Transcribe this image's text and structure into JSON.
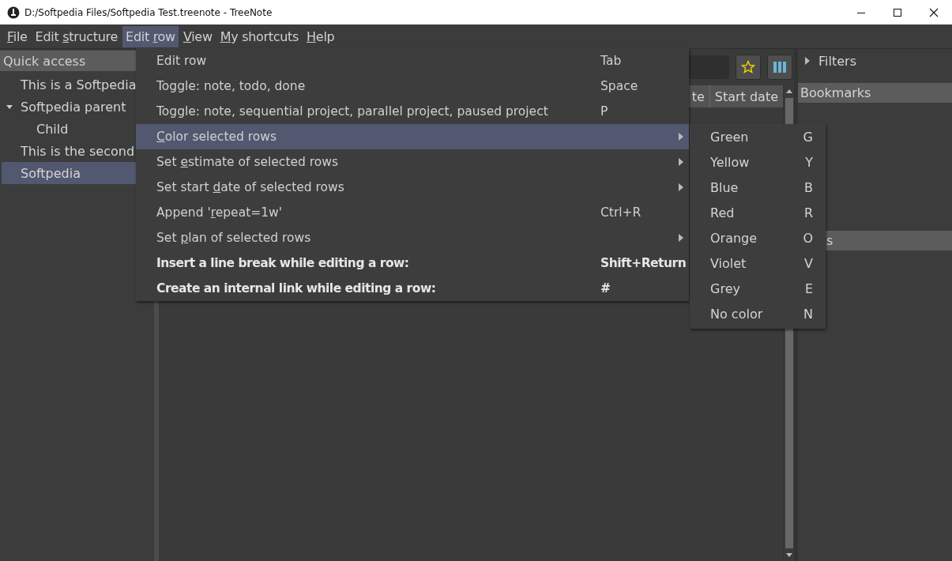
{
  "window": {
    "title": "D:/Softpedia Files/Softpedia Test.treenote - TreeNote"
  },
  "menu_bar": [
    {
      "label": {
        "key": "F",
        "after": "ile"
      },
      "selected": false
    },
    {
      "label": {
        "before": "Edit ",
        "key": "s",
        "after": "tructure"
      },
      "selected": false
    },
    {
      "label": {
        "before": "Edit ",
        "key": "r",
        "after": "ow"
      },
      "selected": true
    },
    {
      "label": {
        "key": "V",
        "after": "iew"
      },
      "selected": false
    },
    {
      "label": {
        "key": "M",
        "after": "y shortcuts"
      },
      "selected": false
    },
    {
      "label": {
        "key": "H",
        "after": "elp"
      },
      "selected": false
    }
  ],
  "sidebar": {
    "title": "Quick access",
    "items": [
      {
        "label": "This is a Softpedia",
        "selected": false
      },
      {
        "label": "Softpedia parent",
        "selected": false,
        "expanded": true,
        "children": [
          {
            "label": "Child",
            "selected": false
          }
        ]
      },
      {
        "label": "This is the second",
        "selected": false
      },
      {
        "label": "Softpedia",
        "selected": true
      }
    ]
  },
  "table": {
    "columns": [
      "te",
      "Start date"
    ]
  },
  "right_panel": {
    "filters": {
      "label": "Filters",
      "expanded": false
    },
    "sections": [
      "Bookmarks",
      "s"
    ]
  },
  "menu": {
    "items": [
      {
        "kind": "command",
        "label": "Edit row",
        "shortcut": "Tab",
        "submenu": false,
        "selected": false
      },
      {
        "kind": "command",
        "label": "Toggle: note, todo, done",
        "shortcut": "Space",
        "submenu": false,
        "selected": false
      },
      {
        "kind": "command",
        "label": "Toggle: note, sequential project, parallel project, paused project",
        "shortcut": "P",
        "submenu": false,
        "selected": false
      },
      {
        "kind": "command",
        "label": {
          "key": "C",
          "after": "olor selected rows"
        },
        "submenu": true,
        "selected": true
      },
      {
        "kind": "command",
        "label": {
          "before": "Set ",
          "key": "e",
          "after": "stimate of selected rows"
        },
        "submenu": true,
        "selected": false
      },
      {
        "kind": "command",
        "label": {
          "before": "Set start ",
          "key": "d",
          "after": "ate of selected rows"
        },
        "submenu": true,
        "selected": false
      },
      {
        "kind": "command",
        "label": {
          "before": "Append '",
          "key": "r",
          "after": "epeat=1w'"
        },
        "shortcut": "Ctrl+R",
        "submenu": false,
        "selected": false
      },
      {
        "kind": "command",
        "label": {
          "before": "Set ",
          "key": "p",
          "after": "lan of selected rows"
        },
        "submenu": true,
        "selected": false
      },
      {
        "kind": "hint",
        "label": "Insert a line break while editing a row:",
        "shortcut": "Shift+Return",
        "submenu": false,
        "selected": false
      },
      {
        "kind": "hint",
        "label": "Create an internal link while editing a row:",
        "shortcut": "#",
        "submenu": false,
        "selected": false
      }
    ]
  },
  "submenu": {
    "items": [
      {
        "label": "Green",
        "shortcut": "G",
        "selected": false
      },
      {
        "label": "Yellow",
        "shortcut": "Y",
        "selected": false
      },
      {
        "label": "Blue",
        "shortcut": "B",
        "selected": false
      },
      {
        "label": "Red",
        "shortcut": "R",
        "selected": false
      },
      {
        "label": "Orange",
        "shortcut": "O",
        "selected": false
      },
      {
        "label": "Violet",
        "shortcut": "V",
        "selected": false
      },
      {
        "label": "Grey",
        "shortcut": "E",
        "selected": false
      },
      {
        "label": "No color",
        "shortcut": "N",
        "selected": false
      }
    ]
  }
}
